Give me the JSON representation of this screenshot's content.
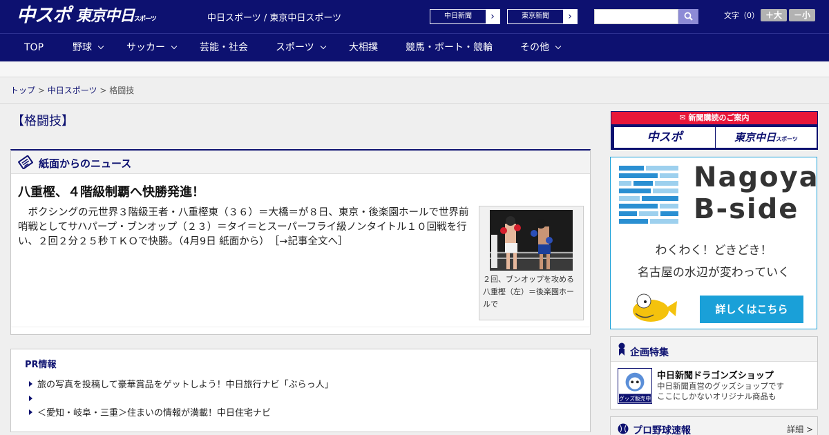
{
  "header": {
    "logo_main": "中スポ",
    "logo_tokyo": "東京中日",
    "logo_tokyo_small": "スポーツ",
    "site_title": "中日スポーツ / 東京中日スポーツ",
    "paper_links": [
      {
        "label": "中日新聞"
      },
      {
        "label": "東京新聞"
      }
    ],
    "search": {
      "placeholder": "",
      "value": ""
    },
    "font_size_label": "文字（0）",
    "font_larger": "＋大",
    "font_smaller": "－小"
  },
  "nav": {
    "items": [
      {
        "label": "TOP",
        "has_menu": false
      },
      {
        "label": "野球",
        "has_menu": true
      },
      {
        "label": "サッカー",
        "has_menu": true
      },
      {
        "label": "芸能・社会",
        "has_menu": false
      },
      {
        "label": "スポーツ",
        "has_menu": true
      },
      {
        "label": "大相撲",
        "has_menu": false
      },
      {
        "label": "競馬・ボート・競輪",
        "has_menu": false
      },
      {
        "label": "その他",
        "has_menu": true
      }
    ]
  },
  "breadcrumb": {
    "items": [
      "トップ",
      "中日スポーツ",
      "格闘技"
    ],
    "separator": ">"
  },
  "page": {
    "heading": "【格闘技】"
  },
  "news": {
    "section_title": "紙面からのニュース",
    "article": {
      "title": "八重樫、４階級制覇へ快勝発進！",
      "body": "ボクシングの元世界３階級王者・八重樫東（３６）＝大橋＝が８日、東京・後楽園ホールで世界前哨戦としてサハパープ・ブンオップ（２３）＝タイ＝とスーパーフライ級ノンタイトル１０回戦を行い、２回２分２５秒ＴＫＯで快勝。（4月9日 紙面から）",
      "more": "［→記事全文へ］",
      "photo_caption": "２回、ブンオップを攻める八重樫（左）＝後楽園ホールで"
    }
  },
  "pr": {
    "title": "PR情報",
    "items": [
      "旅の写真を投稿して豪華賞品をゲットしよう！中日旅行ナビ「ぶらっ人」",
      "",
      "＜愛知・岐阜・三重＞住まいの情報が満載！中日住宅ナビ"
    ]
  },
  "sidebar": {
    "subscribe": {
      "header": "新聞購読のご案内",
      "logo_chuspo": "中スポ",
      "logo_tokyo": "東京中日",
      "logo_tokyo_small": "スポーツ"
    },
    "bside": {
      "title_line1": "Nagoya",
      "title_line2": "B-side",
      "tagline1": "わくわく！どきどき！",
      "tagline2": "名古屋の水辺が変わっていく",
      "button": "詳しくはこちら"
    },
    "feature": {
      "title": "企画特集",
      "item_name": "中日新聞ドラゴンズショップ",
      "item_desc1": "中日新聞直営のグッズショップです",
      "item_desc2": "ここにしかないオリジナル商品も",
      "img_label": "グッズ販売中"
    },
    "baseball": {
      "title": "プロ野球速報",
      "more": "詳細 >"
    }
  },
  "colors": {
    "brand_navy": "#0d1170",
    "subscribe_red": "#e8173a",
    "bside_blue": "#1aa0d8"
  }
}
